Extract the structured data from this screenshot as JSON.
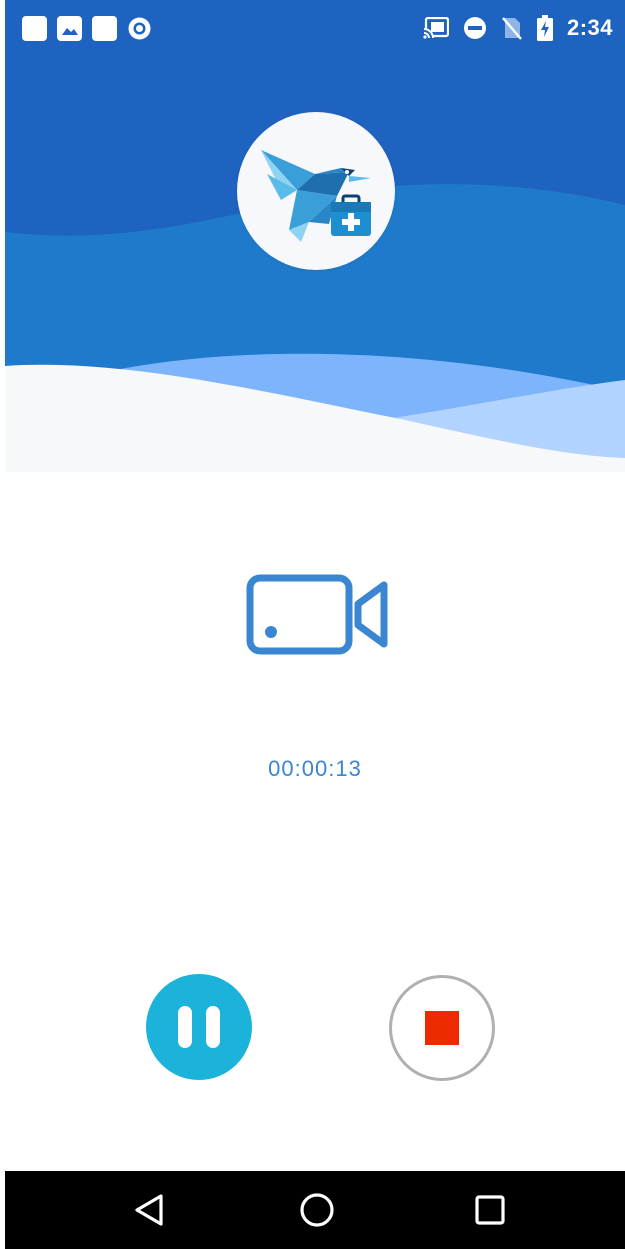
{
  "status_bar": {
    "time": "2:34",
    "left_icons": [
      "app-notification-icon",
      "image-notification-icon",
      "app-notification-icon",
      "record-notification-icon"
    ],
    "right_icons": [
      "cast-icon",
      "do-not-disturb-icon",
      "no-sim-icon",
      "battery-charging-icon"
    ]
  },
  "header": {
    "logo_icon": "bird-medical-kit-logo-icon",
    "colors": {
      "bg_top": "#1e63bf",
      "wave_mid": "#1f7acb",
      "wave_light": "#7eb4fb",
      "wave_lighter": "#b2d3fe",
      "wave_bottom": "#f7f8fa"
    }
  },
  "recording": {
    "mode_icon": "video-camera-icon",
    "elapsed": "00:00:13",
    "accent_color": "#3a86d0"
  },
  "controls": {
    "pause_icon": "pause-icon",
    "stop_icon": "stop-icon",
    "pause_color": "#1bb3d9",
    "stop_color": "#ee2a00"
  },
  "nav_bar": {
    "back_icon": "back-triangle-icon",
    "home_icon": "home-circle-icon",
    "recents_icon": "recents-square-icon"
  }
}
